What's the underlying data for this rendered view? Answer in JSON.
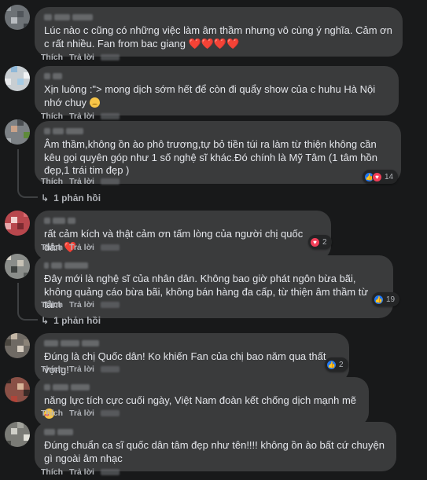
{
  "actions": {
    "like": "Thích",
    "reply": "Trả lời",
    "sep": "·"
  },
  "colors": {
    "background": "#18191a",
    "bubble": "#3a3b3c",
    "text": "#e4e6eb",
    "muted": "#b0b3b8",
    "like_blue": "#2078f4",
    "love_red": "#f33e58"
  },
  "comments": [
    {
      "text": "Lúc nào c cũng có những việc làm âm thầm nhưng vô cùng ý nghĩa. Cảm ơn c rất nhiều. Fan from bac giang",
      "emoji": "❤️❤️❤️❤️"
    },
    {
      "text": "Xịn luông :\"> mong dịch sớm hết để còn đi quẩy show của c huhu Hà Nội nhớ chuy",
      "emoji_icon": "sad-face-icon"
    },
    {
      "text": "Âm thầm,không ồn ào phô trương,tự bỏ tiền túi ra làm từ thiện không cần kêu gọi quyên góp như 1 số nghệ sĩ khác.Đó chính là Mỹ Tâm (1 tâm hồn đẹp,1 trái tim đẹp )",
      "reaction_count": "14",
      "replies_label": "1 phản hồi"
    },
    {
      "text": "rất cảm kích và thật cảm ơn tấm lòng của người chị quốc dân",
      "emoji": "❤️",
      "reaction_count": "2"
    },
    {
      "text": "Đây mới là nghệ sĩ của nhân dân. Không bao giờ phát ngôn bừa bãi, không quảng cáo bừa bãi, không bán hàng đa cấp, từ thiện âm thầm từ tâm",
      "reaction_count": "19",
      "replies_label": "1 phản hồi"
    },
    {
      "text": "Đúng là chị Quốc dân! Ko khiến Fan của chị bao năm qua thất vọng!",
      "reaction_count": "2"
    },
    {
      "text": "năng lực tích cực cuối ngày, Việt Nam đoàn kết chống dịch mạnh mẽ",
      "emoji_icon": "smiling-face-with-hearts-icon"
    },
    {
      "text": "Đúng chuẩn ca sĩ quốc dân tâm đẹp như tên!!!! không ồn ào bất cứ chuyện gì ngoài âm nhạc"
    }
  ]
}
